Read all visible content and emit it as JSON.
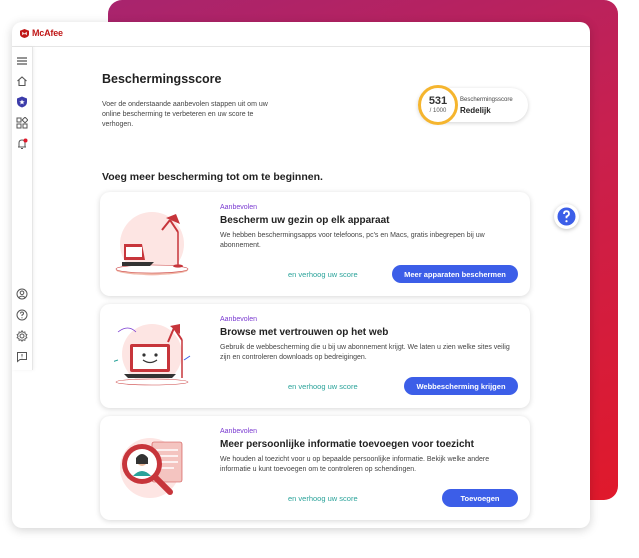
{
  "app": {
    "logo_text": "McAfee"
  },
  "colors": {
    "accent": "#3c5ee8",
    "brand": "#c01818",
    "link": "#2aa39a",
    "tag": "#7a3ad1",
    "score_ring": "#f5b52e"
  },
  "sidebar": {
    "items": [
      {
        "icon": "menu-icon"
      },
      {
        "icon": "home-icon"
      },
      {
        "icon": "shield-icon",
        "active": true
      },
      {
        "icon": "apps-grid-icon"
      },
      {
        "icon": "alert-bell-icon"
      },
      {
        "icon": "account-icon"
      },
      {
        "icon": "help-icon"
      },
      {
        "icon": "settings-icon"
      },
      {
        "icon": "feedback-icon"
      }
    ]
  },
  "header": {
    "title": "Beschermingsscore",
    "description": "Voer de onderstaande aanbevolen stappen uit om uw online bescherming te verbeteren en uw score te verhogen."
  },
  "score": {
    "value": "531",
    "max": "/ 1000",
    "label": "Beschermingsscore",
    "rating": "Redelijk",
    "fraction": 0.531
  },
  "section_heading": "Voeg meer bescherming tot om te beginnen.",
  "cards": [
    {
      "tag": "Aanbevolen",
      "title": "Bescherm uw gezin op elk apparaat",
      "description": "We hebben beschermingsapps voor telefoons, pc's en Macs, gratis inbegrepen bij uw abonnement.",
      "link": "en verhoog uw score",
      "button": "Meer apparaten beschermen"
    },
    {
      "tag": "Aanbevolen",
      "title": "Browse met vertrouwen op het web",
      "description": "Gebruik de webbescherming die u bij uw abonnement krijgt. We laten u zien welke sites veilig zijn en controleren downloads op bedreigingen.",
      "link": "en verhoog uw score",
      "button": "Webbescherming krijgen"
    },
    {
      "tag": "Aanbevolen",
      "title": "Meer persoonlijke informatie toevoegen voor toezicht",
      "description": "We houden al toezicht voor u op bepaalde persoonlijke informatie. Bekijk welke andere informatie u kunt toevoegen om te controleren op schendingen.",
      "link": "en verhoog uw score",
      "button": "Toevoegen"
    }
  ],
  "help": {
    "icon": "question-help-icon"
  }
}
